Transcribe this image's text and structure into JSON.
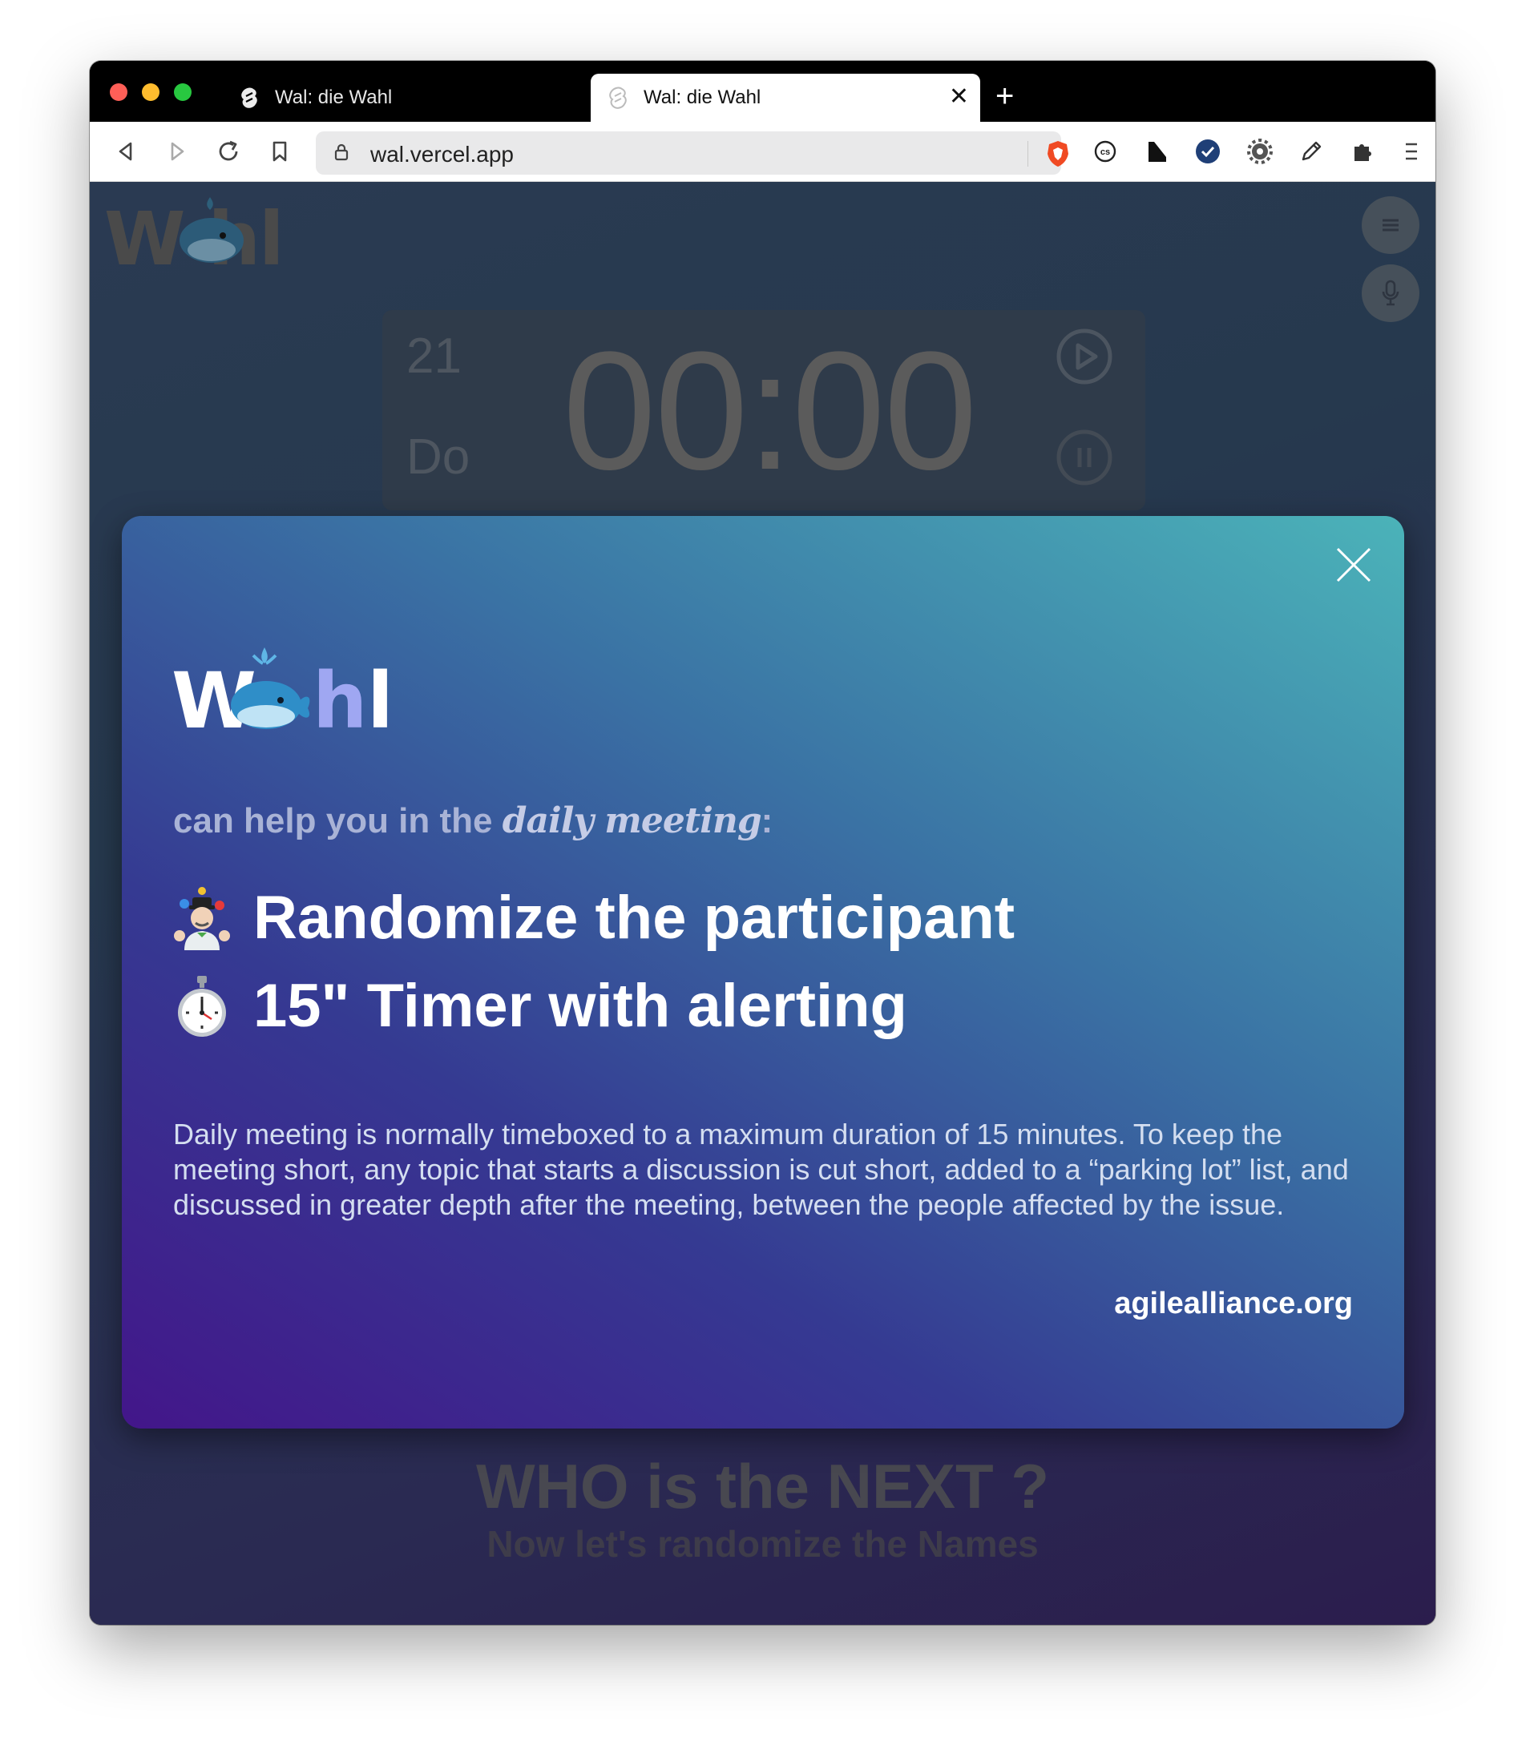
{
  "browser": {
    "tabs": [
      {
        "title": "Wal: die Wahl",
        "active": false
      },
      {
        "title": "Wal: die Wahl",
        "active": true
      }
    ],
    "url": "wal.vercel.app"
  },
  "background": {
    "logo": "W hl",
    "timer": {
      "date_number": "21",
      "weekday": "Do",
      "time": "00:00"
    },
    "headline": "WHO is the NEXT ?",
    "subheadline": "Now let's randomize the Names"
  },
  "modal": {
    "tagline_prefix": "can help you in the ",
    "tagline_highlight": "daily meeting",
    "tagline_suffix": ":",
    "features": [
      {
        "icon": "juggler-emoji",
        "text": "Randomize the participant"
      },
      {
        "icon": "stopwatch-emoji",
        "text": "15\" Timer with alerting"
      }
    ],
    "description": "Daily meeting is normally timeboxed to a maximum duration of 15 minutes. To keep the meeting short, any topic that starts a discussion is cut short, added to a “parking lot” list, and discussed in greater depth after the meeting, between the people affected by the issue.",
    "source": "agilealliance.org"
  },
  "colors": {
    "modal_start": "#43168a",
    "modal_end": "#4bb3b9",
    "page_bg": "#26394e",
    "traffic_red": "#fe5f57",
    "traffic_yellow": "#febc2e",
    "traffic_green": "#28c840"
  }
}
